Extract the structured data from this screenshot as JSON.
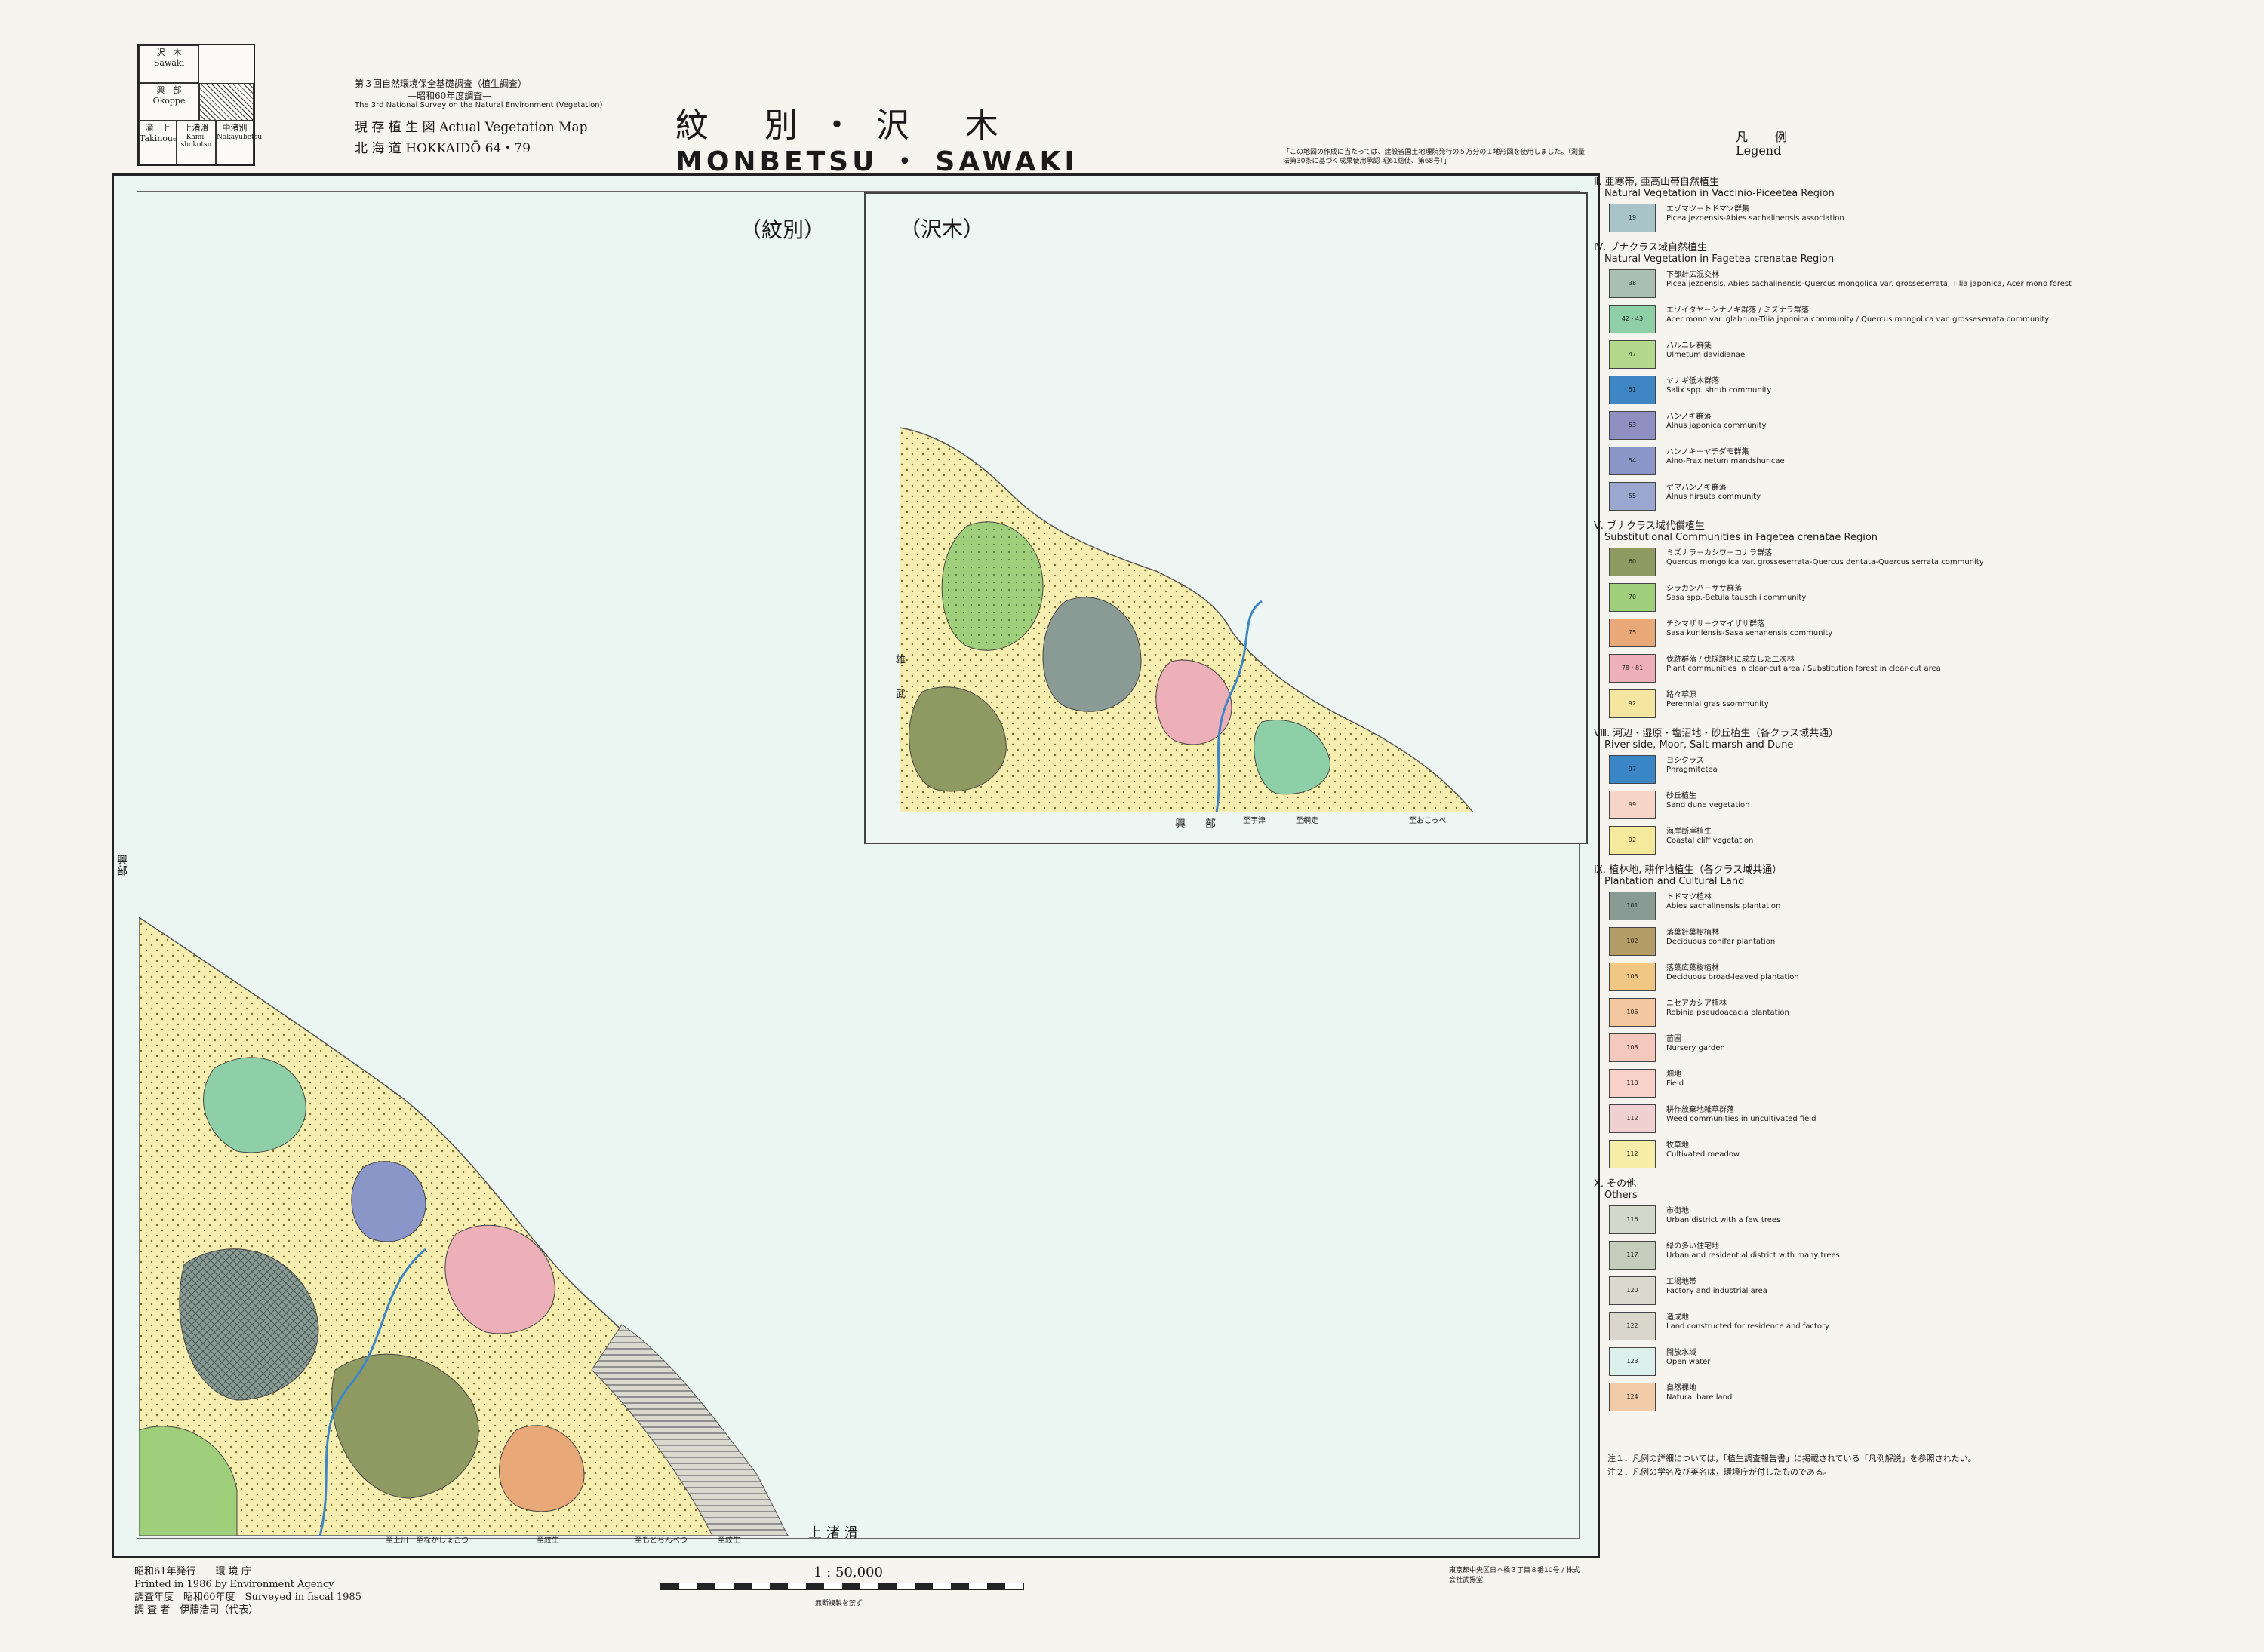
{
  "index_map": {
    "cells": [
      {
        "label": "沢　木",
        "sub": "Sawaki"
      },
      {
        "label": "興　部",
        "sub": "Okoppe"
      },
      {
        "label": "滝　上",
        "sub": "Takinoue"
      },
      {
        "label": "上渚滑",
        "sub": "Kami-shokotsu"
      },
      {
        "label": "中渚別",
        "sub": "Nakayubetsu"
      }
    ]
  },
  "header": {
    "survey_jp": "第３回自然環境保全基礎調査（植生調査）",
    "survey_year_jp": "—昭和60年度調査—",
    "survey_en": "The 3rd National Survey on the Natural Environment (Vegetation)",
    "map_type": "現 存 植 生 図 Actual Vegetation Map",
    "region": "北 海 道 HOKKAIDŌ 64・79",
    "title_jp": "紋 別・沢 木",
    "title_en": "MONBETSU ・ SAWAKI",
    "note": "「この地図の作成に当たっては、建設省国土地理院発行の５万分の１地形図を使用しました。（測量法第30条に基づく成果使用承認 昭61総使、第68号）」"
  },
  "map": {
    "sheet_monbetsu": "（紋別）",
    "sheet_sawaki": "（沢木）",
    "inset_bottom_label": "興　部",
    "inset_side_label": "雄　武",
    "main_side_label": "興部",
    "bottom_label": "上渚滑",
    "bottom_places": [
      "至上川",
      "至なかしょこつ",
      "至紋生",
      "至もとらんべつ",
      "至紋生"
    ],
    "inset_places": [
      "至宇津",
      "至網走",
      "至おこっぺ"
    ]
  },
  "legend": {
    "title_jp": "凡　例",
    "title_en": "Legend",
    "sections": [
      {
        "heading": "Ⅱ. 亜寒帯, 亜高山帯自然植生",
        "heading_en": "Natural Vegetation in Vaccinio-Piceetea Region",
        "items": [
          {
            "code": "19",
            "color": "#a8c4c8",
            "jp": "エゾマツ－トドマツ群集",
            "en": "Picea jezoensis-Abies sachalinensis association"
          }
        ]
      },
      {
        "heading": "Ⅳ. ブナクラス域自然植生",
        "heading_en": "Natural Vegetation in Fagetea crenatae Region",
        "items": [
          {
            "code": "38",
            "color": "#a9bfb4",
            "jp": "下部針広混交林",
            "en": "Picea jezoensis, Abies sachalinensis-Quercus mongolica var. grosseserrata, Tilia japonica, Acer mono forest"
          },
          {
            "code": "42・43",
            "color": "#8fcfa8",
            "jp": "エゾイタヤ－シナノキ群落 / ミズナラ群落",
            "en": "Acer mono var. glabrum-Tilia japonica community / Quercus mongolica var. grosseserrata community"
          },
          {
            "code": "47",
            "color": "#b4d98c",
            "jp": "ハルニレ群集",
            "en": "Ulmetum davidianae"
          },
          {
            "code": "51",
            "color": "#3f86c4",
            "jp": "ヤナギ低木群落",
            "en": "Salix spp. shrub community"
          },
          {
            "code": "53",
            "color": "#8f8fc2",
            "jp": "ハンノキ群落",
            "en": "Alnus japonica community"
          },
          {
            "code": "54",
            "color": "#8a96c8",
            "jp": "ハンノキ－ヤチダモ群集",
            "en": "Alno-Fraxinetum mandshuricae"
          },
          {
            "code": "55",
            "color": "#9aa8d0",
            "jp": "ヤマハンノキ群落",
            "en": "Alnus hirsuta community"
          }
        ]
      },
      {
        "heading": "Ⅴ. ブナクラス域代償植生",
        "heading_en": "Substitutional Communities in Fagetea crenatae Region",
        "items": [
          {
            "code": "60",
            "color": "#8f9a62",
            "jp": "ミズナラ－カシワ－コナラ群落",
            "en": "Quercus mongolica var. grosseserrata-Quercus dentata-Quercus serrata community"
          },
          {
            "code": "70",
            "color": "#9fcf7a",
            "jp": "シラカンバ－ササ群落",
            "en": "Sasa spp.-Betula tauschii community"
          },
          {
            "code": "75",
            "color": "#e8a878",
            "jp": "チシマザサ－クマイザサ群落",
            "en": "Sasa kurilensis-Sasa senanensis community"
          },
          {
            "code": "78・81",
            "color": "#eeb0b8",
            "jp": "伐跡群落 / 伐採跡地に成立した二次林",
            "en": "Plant communities in clear-cut area / Substitution forest in clear-cut area"
          },
          {
            "code": "92",
            "color": "#f4e6a0",
            "jp": "路々草原",
            "en": "Perennial gras ssommunity"
          }
        ]
      },
      {
        "heading": "Ⅷ. 河辺・湿原・塩沼地・砂丘植生（各クラス域共通）",
        "heading_en": "River-side, Moor, Salt marsh and Dune",
        "items": [
          {
            "code": "97",
            "color": "#3a86c6",
            "jp": "ヨシクラス",
            "en": "Phragmitetea"
          },
          {
            "code": "99",
            "color": "#f6d4c8",
            "jp": "砂丘植生",
            "en": "Sand dune vegetation"
          },
          {
            "code": "92",
            "color": "#f5ea9c",
            "jp": "海岸断崖植生",
            "en": "Coastal cliff vegetation"
          }
        ]
      },
      {
        "heading": "Ⅸ. 植林地, 耕作地植生（各クラス域共通）",
        "heading_en": "Plantation and Cultural Land",
        "items": [
          {
            "code": "101",
            "color": "#8a9a94",
            "jp": "トドマツ植林",
            "en": "Abies sachalinensis plantation"
          },
          {
            "code": "102",
            "color": "#b49c66",
            "jp": "落葉針葉樹植林",
            "en": "Deciduous conifer plantation"
          },
          {
            "code": "105",
            "color": "#f0c884",
            "jp": "落葉広葉樹植林",
            "en": "Deciduous broad-leaved plantation"
          },
          {
            "code": "106",
            "color": "#f3c8a0",
            "jp": "ニセアカシア植林",
            "en": "Robinia pseudoacacia plantation"
          },
          {
            "code": "108",
            "color": "#f4c8bc",
            "jp": "苗圃",
            "en": "Nursery garden"
          },
          {
            "code": "110",
            "color": "#f8d2c8",
            "jp": "畑地",
            "en": "Field"
          },
          {
            "code": "112",
            "color": "#f0d0d0",
            "jp": "耕作放棄地雑草群落",
            "en": "Weed communities in uncultivated field"
          },
          {
            "code": "112",
            "color": "#f6eea8",
            "jp": "牧草地",
            "en": "Cultivated meadow"
          }
        ]
      },
      {
        "heading": "Ⅹ. その他",
        "heading_en": "Others",
        "items": [
          {
            "code": "116",
            "color": "#d4d8cc",
            "jp": "市街地",
            "en": "Urban district with a few trees"
          },
          {
            "code": "117",
            "color": "#c6cdbc",
            "jp": "緑の多い住宅地",
            "en": "Urban and residential district with many trees"
          },
          {
            "code": "120",
            "color": "#d9d9d0",
            "jp": "工場地帯",
            "en": "Factory and industrial area"
          },
          {
            "code": "122",
            "color": "#d9d6cc",
            "jp": "造成地",
            "en": "Land constructed for residence and factory"
          },
          {
            "code": "123",
            "color": "#dcf0ec",
            "jp": "開放水域",
            "en": "Open water"
          },
          {
            "code": "124",
            "color": "#f2cca8",
            "jp": "自然裸地",
            "en": "Natural bare land"
          }
        ]
      }
    ],
    "notes": [
      "注１．凡例の詳細については，「植生調査報告書」に掲載されている「凡例解説」を参照されたい。",
      "注２．凡例の学名及び英名は，環境庁が付したものである。"
    ]
  },
  "footer": {
    "issued": "昭和61年発行　　環 境 庁",
    "printed": "Printed in 1986 by Environment Agency",
    "surveyed": "調査年度　昭和60年度　Surveyed in fiscal 1985",
    "surveyor": "調 査 者　伊藤浩司（代表）",
    "scale": "1 : 50,000",
    "reproduction": "無断複製を禁ず",
    "printer": "東京都中央区日本橋３丁目８番10号 / 株式会社武揚堂"
  }
}
